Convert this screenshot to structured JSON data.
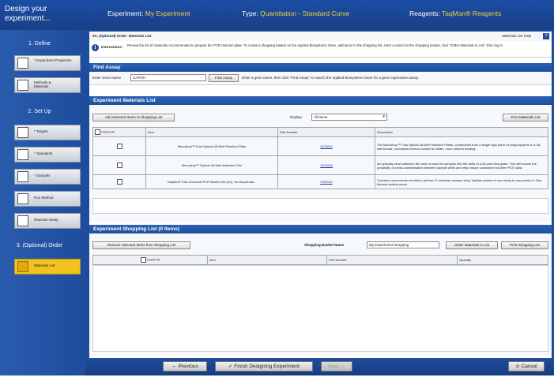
{
  "header": {
    "sidebar_title": "Design your experiment...",
    "experiment_label": "Experiment:",
    "experiment_value": "My Experiment",
    "type_label": "Type:",
    "type_value": "Quantitation - Standard Curve",
    "reagents_label": "Reagents:",
    "reagents_value": "TaqMan® Reagents"
  },
  "sidebar": {
    "section1": "1. Define",
    "section2": "2. Set Up",
    "section3": "3. (Optional) Order",
    "items": [
      {
        "label": "* Experiment Properties",
        "icon": "experiment-properties-icon"
      },
      {
        "label": "Methods & Materials",
        "icon": "methods-materials-icon"
      },
      {
        "label": "* Targets",
        "icon": "targets-icon"
      },
      {
        "label": "* Standards",
        "icon": "standards-icon"
      },
      {
        "label": "* Samples",
        "icon": "samples-icon"
      },
      {
        "label": "Run Method",
        "icon": "run-method-icon"
      },
      {
        "label": "Reaction Setup",
        "icon": "reaction-setup-icon"
      },
      {
        "label": "Materials List",
        "icon": "materials-list-icon"
      }
    ]
  },
  "main": {
    "title": "3A. (Optional) Order: Materials List",
    "help_label": "Materials List Help",
    "help_icon": "?",
    "instructions_label": "Instructions:",
    "instructions_text": "Review the list of materials recommended to prepare the PCR reaction plate. To create a shopping basket on the Applied Biosystems Store, add items to the shopping list, enter a name for the shopping basket, click \"Order Materials in List,\" then log in."
  },
  "find_assay": {
    "header": "Find Assay",
    "gene_label": "Enter Gene Name",
    "gene_value": "GAPDH",
    "button": "Find Assay",
    "hint": "Enter a gene name, then click \"Find Assay\" to search the Applied Biosystems Store for a gene expression assay."
  },
  "materials": {
    "header": "Experiment Materials List",
    "add_button": "Add Selected Items to Shopping List",
    "display_label": "Display:",
    "display_value": "All Items",
    "print_button": "Print Materials List",
    "columns": [
      "Check All",
      "Item",
      "Part Number",
      "Description"
    ],
    "rows": [
      {
        "item": "MicroAmp™ Fast Optical 48-Well Reaction Plate",
        "part": "4375816",
        "desc": "The MicroAmp™ Fast Optical 48-Well Reaction Plates, constructed from a single rigid piece of polypropylene in a 48-well format. Increased thermal contact for faster, more uniform heating."
      },
      {
        "item": "MicroAmp™ Optical 48-Well Adhesive Film",
        "part": "4375928",
        "desc": "An optically clear adhesive film used to seal the samples into the wells of a 48-well microplate. This will reduce the possibility of cross-contamination between sample wells and help ensure consistent real-time PCR data."
      },
      {
        "item": "TaqMan® Fast Universal PCR Master Mix (2X), No AmpErase...",
        "part": "4352042",
        "desc": "Contains components needed to perform 5' nuclease assays using TaqMan probes in one ready-to-use premix in Fast thermal cycling mode."
      }
    ]
  },
  "shopping": {
    "header": "Experiment Shopping List (0 Items)",
    "remove_button": "Remove Selected Items from Shopping List",
    "basket_label": "Shopping Basket Name",
    "basket_value": "My Experiment Shopping",
    "order_button": "Order Materials in List",
    "print_button": "Print Shopping List",
    "columns": [
      "Check All",
      "Item",
      "Part Number",
      "Quantity"
    ]
  },
  "footer": {
    "previous": "Previous",
    "finish": "Finish Designing Experiment",
    "next": "Next",
    "cancel": "Cancel"
  },
  "colors": {
    "accent": "#f2c21e",
    "header_bg": "#1d4d9a",
    "highlight_text": "#f2d23a"
  }
}
